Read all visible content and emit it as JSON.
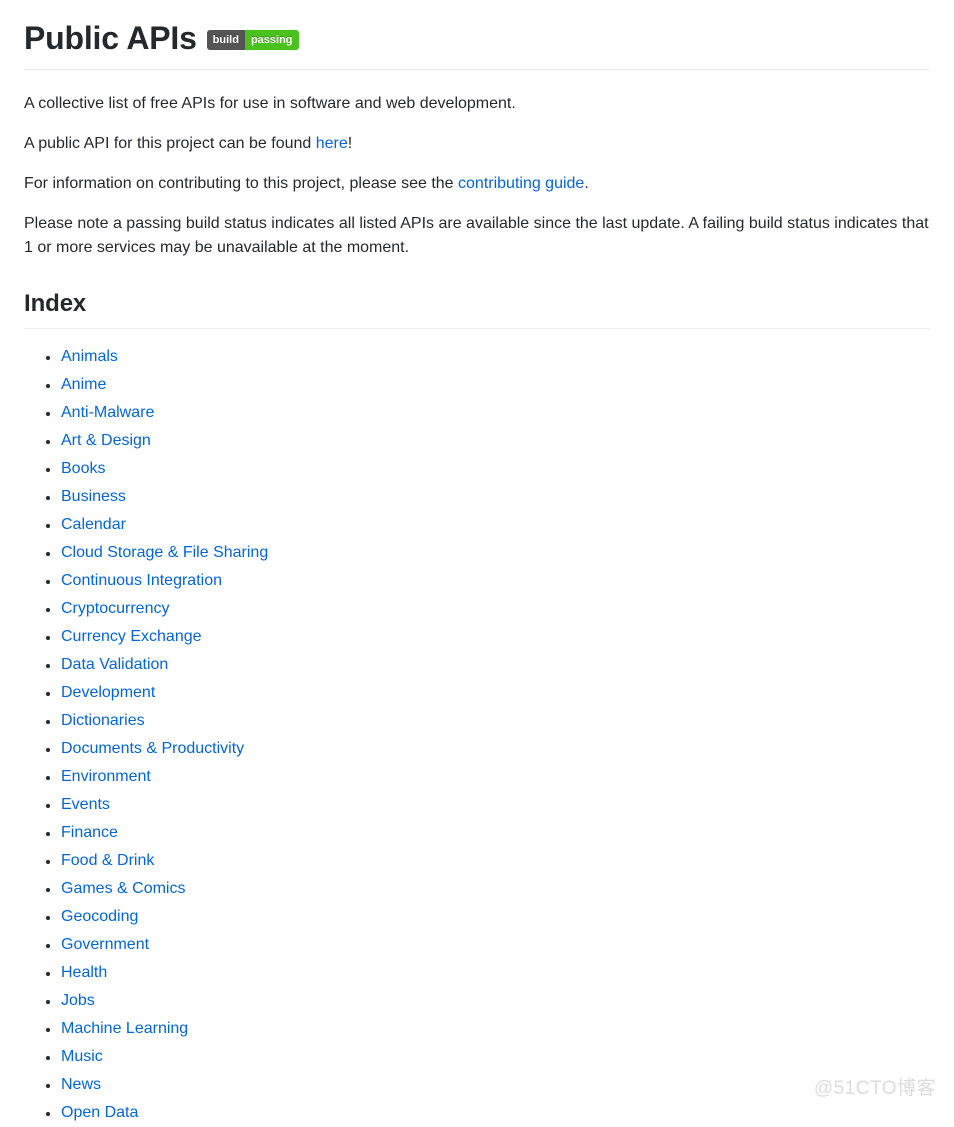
{
  "header": {
    "title": "Public APIs",
    "badge": {
      "left_label": "build",
      "right_label": "passing",
      "left_color": "#555555",
      "right_color": "#4ac11d"
    }
  },
  "intro": {
    "p1": "A collective list of free APIs for use in software and web development.",
    "p2_before": "A public API for this project can be found ",
    "p2_link": "here",
    "p2_after": "!",
    "p3_before": "For information on contributing to this project, please see the ",
    "p3_link": "contributing guide",
    "p3_after": ".",
    "p4": "Please note a passing build status indicates all listed APIs are available since the last update. A failing build status indicates that 1 or more services may be unavailable at the moment."
  },
  "index": {
    "heading": "Index",
    "items": [
      {
        "label": "Animals"
      },
      {
        "label": "Anime"
      },
      {
        "label": "Anti-Malware"
      },
      {
        "label": "Art & Design"
      },
      {
        "label": "Books"
      },
      {
        "label": "Business"
      },
      {
        "label": "Calendar"
      },
      {
        "label": "Cloud Storage & File Sharing"
      },
      {
        "label": "Continuous Integration"
      },
      {
        "label": "Cryptocurrency"
      },
      {
        "label": "Currency Exchange"
      },
      {
        "label": "Data Validation"
      },
      {
        "label": "Development"
      },
      {
        "label": "Dictionaries"
      },
      {
        "label": "Documents & Productivity"
      },
      {
        "label": "Environment"
      },
      {
        "label": "Events"
      },
      {
        "label": "Finance"
      },
      {
        "label": "Food & Drink"
      },
      {
        "label": "Games & Comics"
      },
      {
        "label": "Geocoding"
      },
      {
        "label": "Government"
      },
      {
        "label": "Health"
      },
      {
        "label": "Jobs"
      },
      {
        "label": "Machine Learning"
      },
      {
        "label": "Music"
      },
      {
        "label": "News"
      },
      {
        "label": "Open Data"
      }
    ]
  },
  "watermark": {
    "text": "@51CTO博客"
  },
  "colors": {
    "link": "#0366d6",
    "text": "#24292e",
    "rule": "#eaecef"
  }
}
